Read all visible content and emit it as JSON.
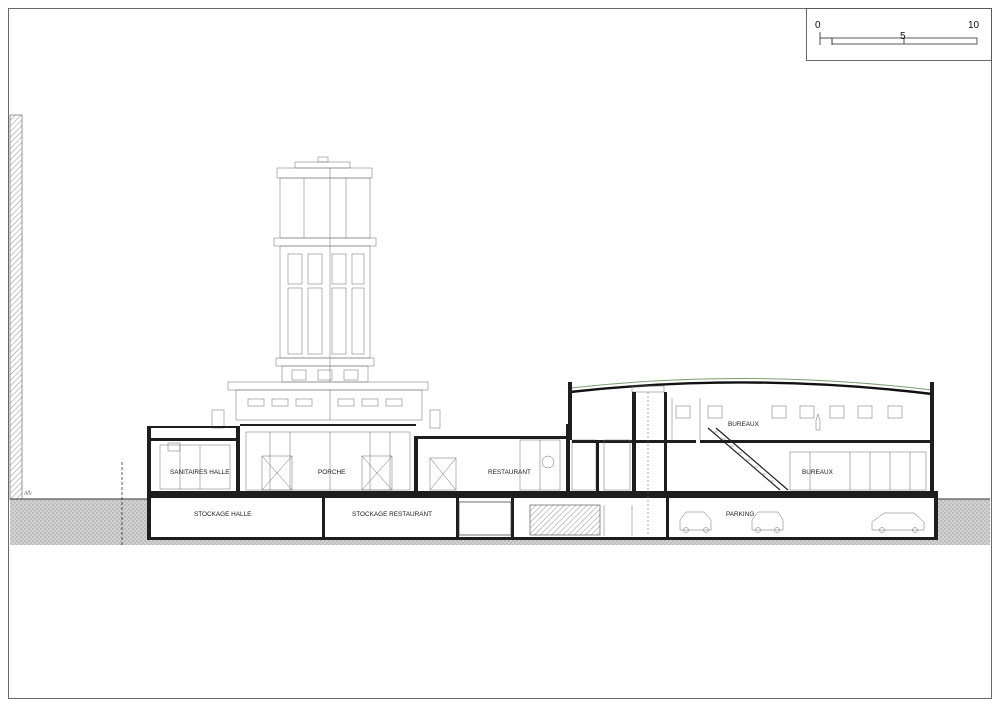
{
  "scale_bar": {
    "tick_0": "0",
    "tick_5": "5",
    "tick_10": "10"
  },
  "rooms": {
    "sanitaires_halle": "SANITAIRES HALLE",
    "porche": "PORCHE",
    "restaurant": "RESTAURANT",
    "bureaux_upper": "BUREAUX",
    "bureaux_lower": "BUREAUX",
    "stockage_halle": "STOCKAGE HALLE",
    "stockage_restaurant": "STOCKAGE RESTAURANT",
    "parking": "PARKING"
  },
  "colors": {
    "ink": "#1e1e1e",
    "line": "#6a6a6a",
    "ground_fill": "#c8c8c8",
    "roof_green": "#7aa070"
  }
}
